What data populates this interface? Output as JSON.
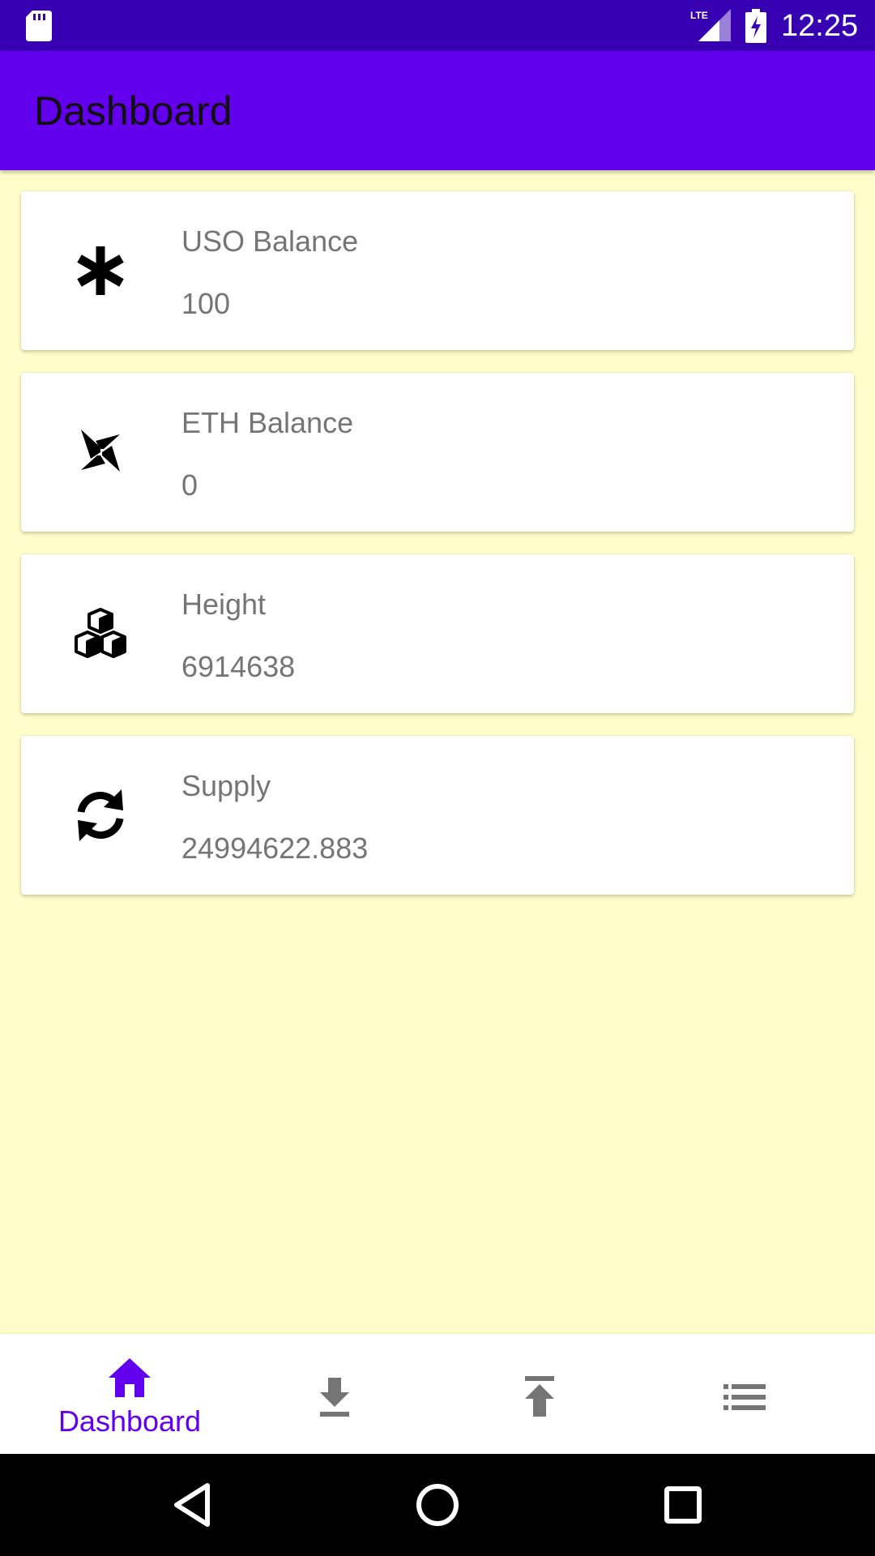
{
  "status_bar": {
    "time": "12:25",
    "network": "LTE",
    "icons": [
      "sd-card-icon",
      "lte-signal-icon",
      "battery-charging-icon"
    ]
  },
  "app_bar": {
    "title": "Dashboard"
  },
  "cards": [
    {
      "icon": "asterisk-icon",
      "label": "USO Balance",
      "value": "100"
    },
    {
      "icon": "ethereum-pinwheel-icon",
      "label": "ETH Balance",
      "value": "0"
    },
    {
      "icon": "cubes-icon",
      "label": "Height",
      "value": "6914638"
    },
    {
      "icon": "sync-icon",
      "label": "Supply",
      "value": "24994622.883"
    }
  ],
  "bottom_nav": {
    "items": [
      {
        "icon": "home-icon",
        "label": "Dashboard",
        "active": true
      },
      {
        "icon": "download-icon",
        "label": "",
        "active": false
      },
      {
        "icon": "upload-icon",
        "label": "",
        "active": false
      },
      {
        "icon": "list-icon",
        "label": "",
        "active": false
      }
    ],
    "active_color": "#6200EE",
    "inactive_color": "#757575"
  },
  "system_nav": {
    "buttons": [
      "back-triangle-icon",
      "home-circle-icon",
      "recents-square-icon"
    ]
  },
  "colors": {
    "status_bar": "#3700B3",
    "app_bar": "#6200EE",
    "background": "#FFFDCA",
    "card": "#FFFFFF",
    "card_text": "#757575"
  }
}
